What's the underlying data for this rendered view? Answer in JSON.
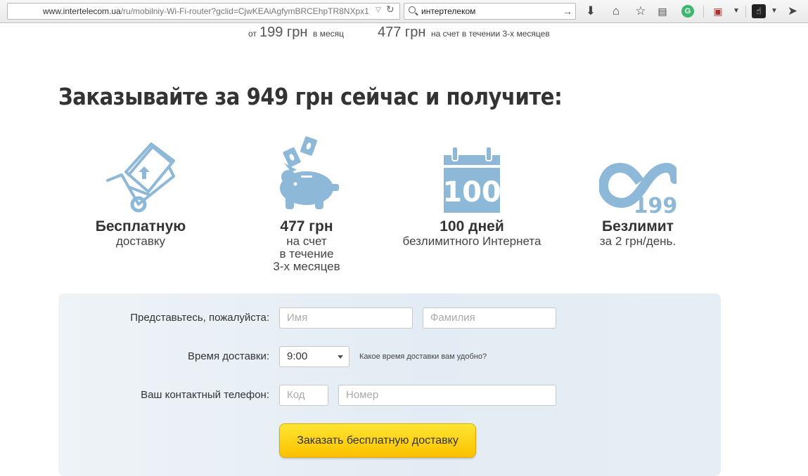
{
  "browser": {
    "url_host": "www.intertelecom.ua",
    "url_path": "/ru/mobilniy-Wi-Fi-router?gclid=CjwKEAiAgfymBRCEhpTR8NXpx1",
    "search_query": "интертелеком"
  },
  "top_prices": {
    "left_prefix": "от",
    "left_big": "199 грн",
    "left_suffix": "в месяц",
    "right_big": "477 грн",
    "right_suffix": "на счет в течении 3-х месяцев"
  },
  "headline": "Заказывайте за 949 грн сейчас и получите:",
  "features": [
    {
      "title": "Бесплатную",
      "subtitle_lines": [
        "доставку"
      ]
    },
    {
      "title": "477 грн",
      "subtitle_lines": [
        "на счет",
        "в течение",
        "3-х месяцев"
      ]
    },
    {
      "title": "100 дней",
      "subtitle_lines": [
        "безлимитного Интернета"
      ],
      "icon_text": "100"
    },
    {
      "title": "Безлимит",
      "subtitle_lines": [
        "за 2 грн/день."
      ],
      "icon_text": "199"
    }
  ],
  "form": {
    "name_label": "Представьтесь, пожалуйста:",
    "first_name_placeholder": "Имя",
    "last_name_placeholder": "Фамилия",
    "time_label": "Время доставки:",
    "time_value": "9:00",
    "time_hint": "Какое время доставки вам удобно?",
    "phone_label": "Ваш контактный телефон:",
    "phone_code_placeholder": "Код",
    "phone_number_placeholder": "Номер",
    "submit_label": "Заказать бесплатную доставку"
  },
  "colors": {
    "icon_blue": "#8db8d8",
    "button_yellow": "#fbc100",
    "heading": "#333333"
  }
}
